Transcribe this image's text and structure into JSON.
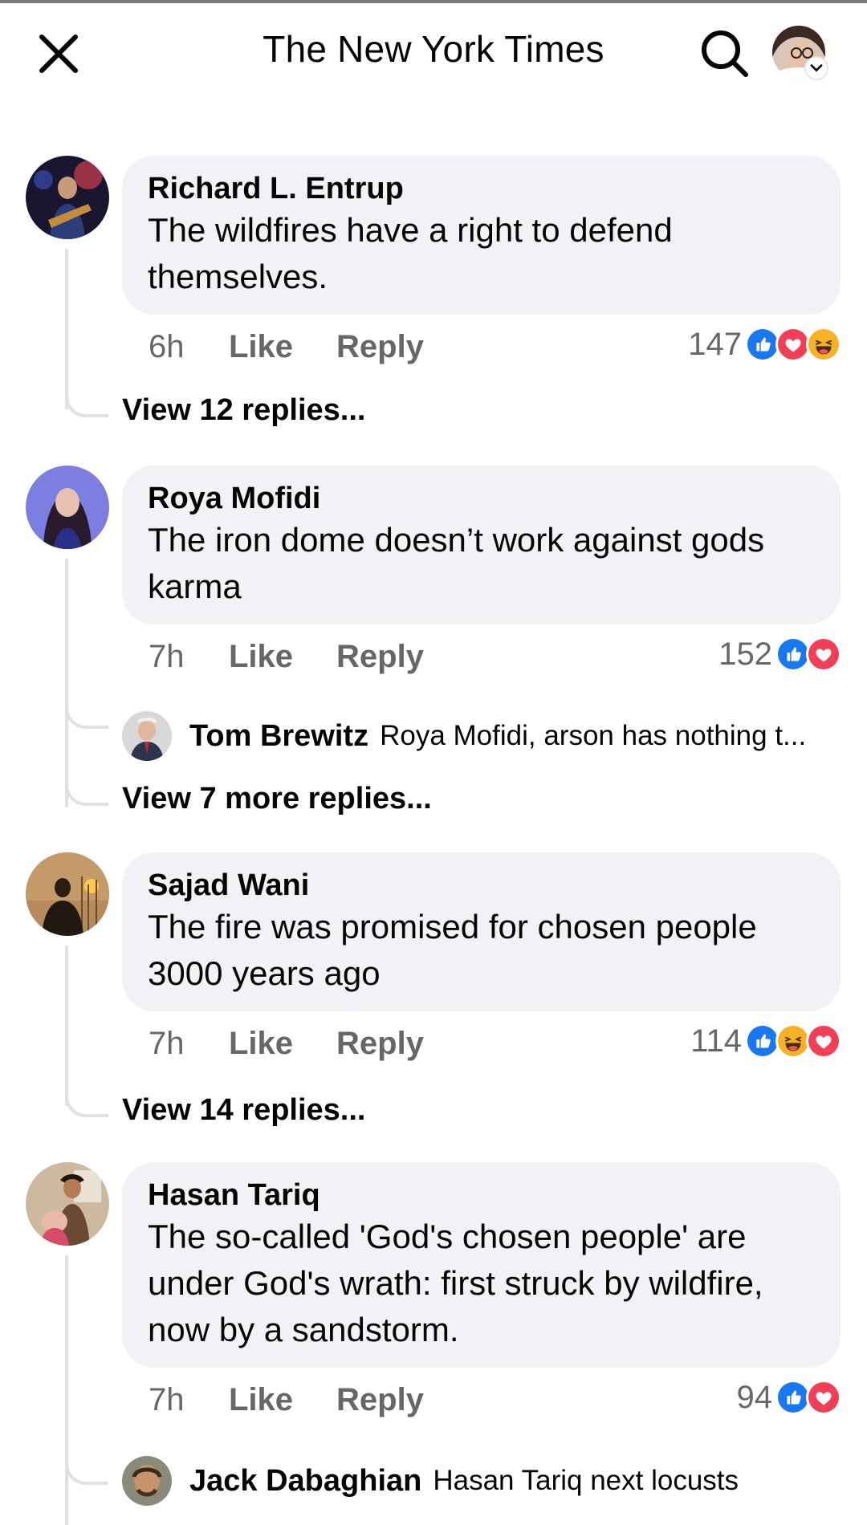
{
  "header": {
    "title": "The New York Times",
    "close_icon": "close-icon",
    "search_icon": "search-icon"
  },
  "colors": {
    "like_blue": "#1877f2",
    "love_red": "#f33e58",
    "haha_yellow": "#f7b125",
    "bubble_bg": "#f0f2f5",
    "meta_gray": "#65676b"
  },
  "comments": [
    {
      "author": "Richard L. Entrup",
      "text": "The wildfires have a right to defend themselves.",
      "time": "6h",
      "like_label": "Like",
      "reply_label": "Reply",
      "reaction_count": "147",
      "reactions": [
        "like",
        "love",
        "haha"
      ],
      "view_replies": "View 12 replies..."
    },
    {
      "author": "Roya Mofidi",
      "text": "The iron dome doesn’t work against gods karma",
      "time": "7h",
      "like_label": "Like",
      "reply_label": "Reply",
      "reaction_count": "152",
      "reactions": [
        "like",
        "love"
      ],
      "reply_preview": {
        "author": "Tom Brewitz",
        "text": "Roya Mofidi, arson has nothing t..."
      },
      "view_replies": "View 7 more replies..."
    },
    {
      "author": "Sajad Wani",
      "text": "The fire was promised for chosen people 3000 years ago",
      "time": "7h",
      "like_label": "Like",
      "reply_label": "Reply",
      "reaction_count": "114",
      "reactions": [
        "like",
        "haha",
        "love"
      ],
      "view_replies": "View 14 replies..."
    },
    {
      "author": "Hasan Tariq",
      "text": "The so-called 'God's chosen people' are under God's wrath: first struck by wildfire, now by a sandstorm.",
      "time": "7h",
      "like_label": "Like",
      "reply_label": "Reply",
      "reaction_count": "94",
      "reactions": [
        "like",
        "love"
      ],
      "reply_preview": {
        "author": "Jack Dabaghian",
        "text": "Hasan Tariq next locusts"
      }
    }
  ]
}
